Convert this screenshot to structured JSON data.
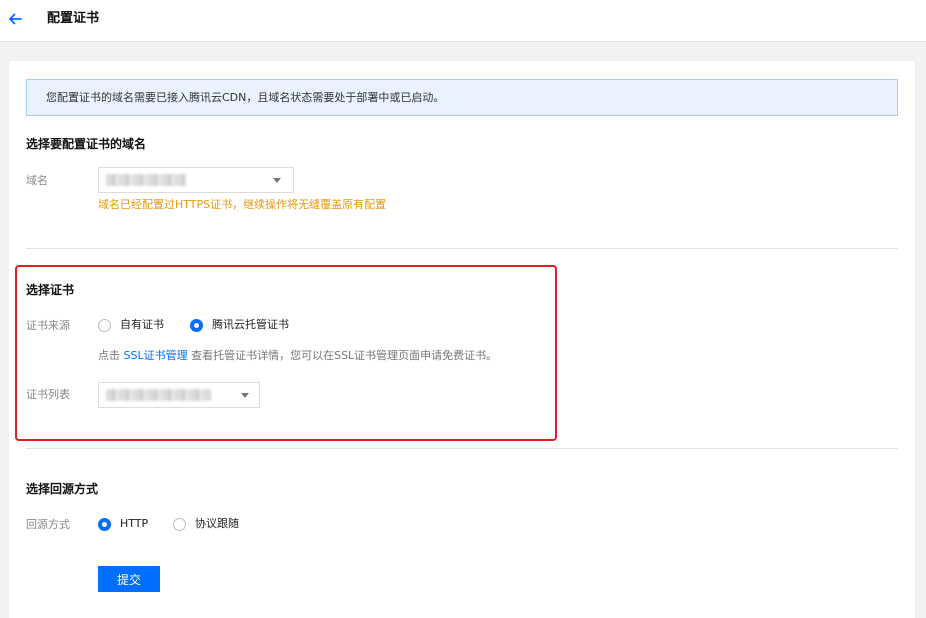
{
  "header": {
    "title": "配置证书",
    "back_icon": "arrow-left-icon"
  },
  "notice": {
    "text": "您配置证书的域名需要已接入腾讯云CDN，且域名状态需要处于部署中或已启动。"
  },
  "domain_section": {
    "title": "选择要配置证书的域名",
    "label": "域名",
    "selected_value": "",
    "warning": "域名已经配置过HTTPS证书，继续操作将无缝覆盖原有配置"
  },
  "cert_section": {
    "title": "选择证书",
    "source_label": "证书来源",
    "options": [
      {
        "label": "自有证书",
        "checked": false
      },
      {
        "label": "腾讯云托管证书",
        "checked": true
      }
    ],
    "hint_prefix": "点击",
    "hint_link": "SSL证书管理",
    "hint_suffix": "查看托管证书详情，您可以在SSL证书管理页面申请免费证书。",
    "list_label": "证书列表",
    "selected_value": ""
  },
  "origin_section": {
    "title": "选择回源方式",
    "label": "回源方式",
    "options": [
      {
        "label": "HTTP",
        "checked": true
      },
      {
        "label": "协议跟随",
        "checked": false
      }
    ]
  },
  "submit": {
    "label": "提交"
  },
  "colors": {
    "primary": "#006eff",
    "warning": "#e59a12",
    "highlight": "#e02020",
    "notice_bg": "#e8f3ff"
  }
}
